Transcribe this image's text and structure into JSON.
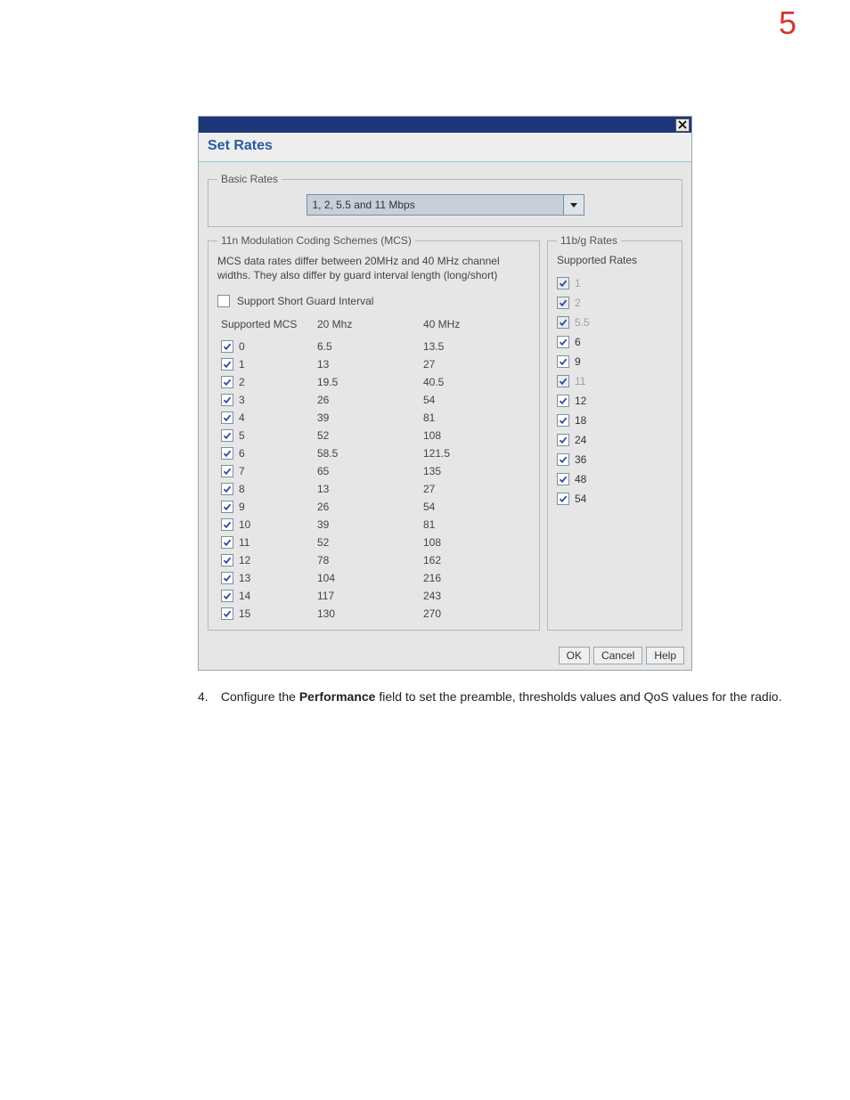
{
  "page_number": "5",
  "dialog": {
    "title": "Set Rates",
    "close_symbol": "✕",
    "basic_rates": {
      "legend": "Basic Rates",
      "selected": "1, 2, 5.5 and 11 Mbps"
    },
    "mcs": {
      "legend": "11n Modulation Coding Schemes (MCS)",
      "note": "MCS data rates differ between 20MHz and 40 MHz channel widths. They also differ by guard interval length (long/short)",
      "sgi_label": "Support Short Guard Interval",
      "sgi_checked": false,
      "col_head_mcs": "Supported MCS",
      "col_head_20": "20 Mhz",
      "col_head_40": "40 MHz",
      "rows": [
        {
          "idx": "0",
          "r20": "6.5",
          "r40": "13.5",
          "checked": true
        },
        {
          "idx": "1",
          "r20": "13",
          "r40": "27",
          "checked": true
        },
        {
          "idx": "2",
          "r20": "19.5",
          "r40": "40.5",
          "checked": true
        },
        {
          "idx": "3",
          "r20": "26",
          "r40": "54",
          "checked": true
        },
        {
          "idx": "4",
          "r20": "39",
          "r40": "81",
          "checked": true
        },
        {
          "idx": "5",
          "r20": "52",
          "r40": "108",
          "checked": true
        },
        {
          "idx": "6",
          "r20": "58.5",
          "r40": "121.5",
          "checked": true
        },
        {
          "idx": "7",
          "r20": "65",
          "r40": "135",
          "checked": true
        },
        {
          "idx": "8",
          "r20": "13",
          "r40": "27",
          "checked": true
        },
        {
          "idx": "9",
          "r20": "26",
          "r40": "54",
          "checked": true
        },
        {
          "idx": "10",
          "r20": "39",
          "r40": "81",
          "checked": true
        },
        {
          "idx": "11",
          "r20": "52",
          "r40": "108",
          "checked": true
        },
        {
          "idx": "12",
          "r20": "78",
          "r40": "162",
          "checked": true
        },
        {
          "idx": "13",
          "r20": "104",
          "r40": "216",
          "checked": true
        },
        {
          "idx": "14",
          "r20": "117",
          "r40": "243",
          "checked": true
        },
        {
          "idx": "15",
          "r20": "130",
          "r40": "270",
          "checked": true
        }
      ]
    },
    "bg_rates": {
      "legend": "11b/g Rates",
      "title": "Supported Rates",
      "rows": [
        {
          "label": "1",
          "checked": true,
          "disabled": true
        },
        {
          "label": "2",
          "checked": true,
          "disabled": true
        },
        {
          "label": "5.5",
          "checked": true,
          "disabled": true
        },
        {
          "label": "6",
          "checked": true,
          "disabled": false
        },
        {
          "label": "9",
          "checked": true,
          "disabled": false
        },
        {
          "label": "11",
          "checked": true,
          "disabled": true
        },
        {
          "label": "12",
          "checked": true,
          "disabled": false
        },
        {
          "label": "18",
          "checked": true,
          "disabled": false
        },
        {
          "label": "24",
          "checked": true,
          "disabled": false
        },
        {
          "label": "36",
          "checked": true,
          "disabled": false
        },
        {
          "label": "48",
          "checked": true,
          "disabled": false
        },
        {
          "label": "54",
          "checked": true,
          "disabled": false
        }
      ]
    },
    "buttons": {
      "ok": "OK",
      "cancel": "Cancel",
      "help": "Help"
    }
  },
  "step": {
    "number": "4.",
    "pre_bold": "Configure the ",
    "bold": "Performance",
    "post_bold": " field to set the preamble, thresholds values and QoS values for the radio."
  }
}
